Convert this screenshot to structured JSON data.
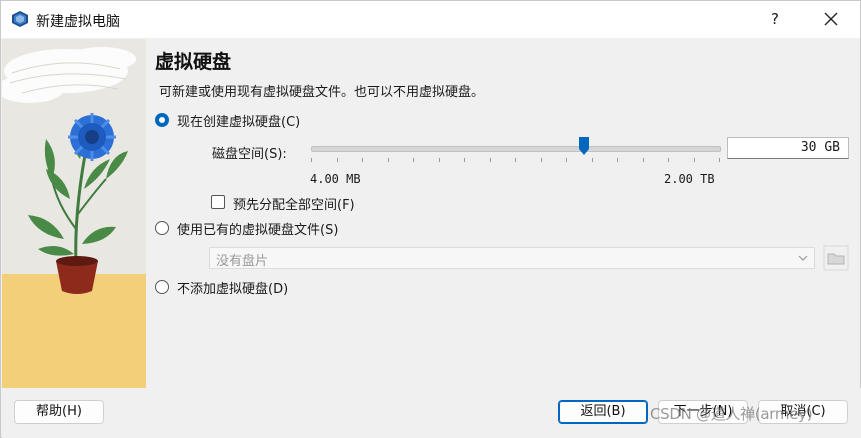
{
  "window": {
    "title": "新建虚拟电脑",
    "help_label": "?"
  },
  "page": {
    "title": "虚拟硬盘",
    "description": "可新建或使用现有虚拟硬盘文件。也可以不用虚拟硬盘。"
  },
  "options": {
    "create_new": {
      "label": "现在创建虚拟硬盘(C)",
      "selected": true
    },
    "disk_size": {
      "label": "磁盘空间(S):",
      "value_text": "30 GB",
      "min_label": "4.00 MB",
      "max_label": "2.00 TB",
      "slider_position_fraction": 0.67
    },
    "preallocate": {
      "label": "预先分配全部空间(F)",
      "checked": false
    },
    "use_existing": {
      "label": "使用已有的虚拟硬盘文件(S)",
      "selected": false
    },
    "existing_file_select": {
      "value": "没有盘片",
      "enabled": false
    },
    "no_disk": {
      "label": "不添加虚拟硬盘(D)",
      "selected": false
    }
  },
  "footer": {
    "help": "帮助(H)",
    "back": "返回(B)",
    "next": "下一步(N)",
    "cancel": "取消(C)",
    "watermark": "CSDN @道人禅(armey)"
  },
  "colors": {
    "accent": "#0067c0",
    "background": "#f0f0f0",
    "side_panel": "#e9e7e1",
    "side_panel_floor": "#f3cf7a"
  },
  "icons": {
    "app": "virtualbox-icon",
    "help": "question-mark",
    "close": "close-icon",
    "select_arrow": "chevron-down-icon",
    "folder": "folder-icon"
  }
}
